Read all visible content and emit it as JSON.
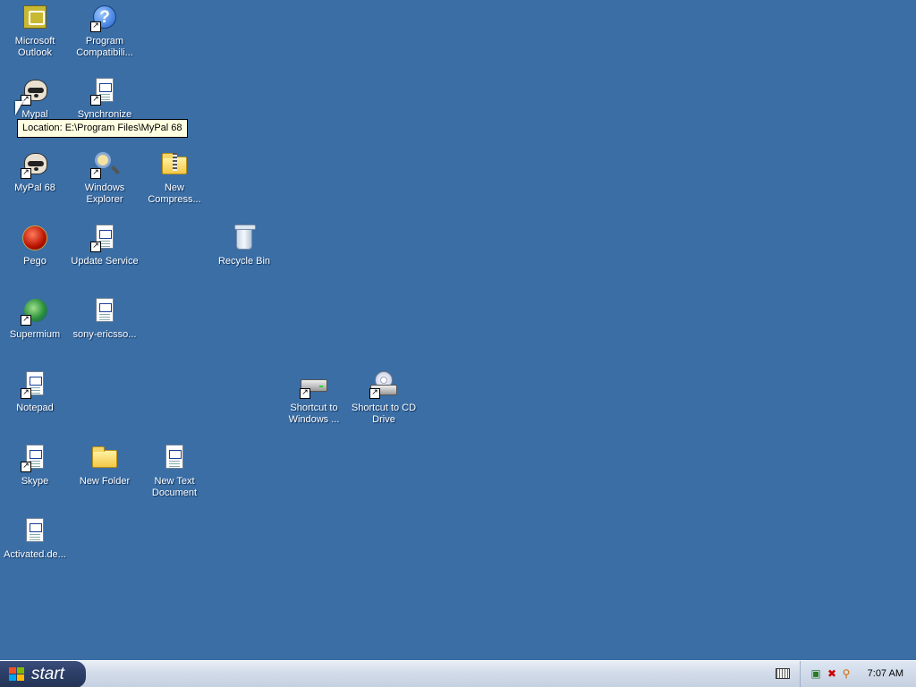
{
  "desktop": {
    "icons": [
      {
        "label": "Microsoft Outlook",
        "icon": "outlook-icon"
      },
      {
        "label": "Program Compatibili...",
        "icon": "help-icon"
      },
      {
        "label": "Mypal",
        "icon": "raccoon-icon"
      },
      {
        "label": "Synchronize",
        "icon": "document-icon"
      },
      {
        "label": "MyPal 68",
        "icon": "raccoon-icon"
      },
      {
        "label": "Windows Explorer",
        "icon": "magnifier-icon"
      },
      {
        "label": "New Compress...",
        "icon": "zip-folder-icon"
      },
      {
        "label": "Pego",
        "icon": "pego-icon"
      },
      {
        "label": "Update Service",
        "icon": "document-icon"
      },
      {
        "label": "Recycle Bin",
        "icon": "recycle-bin-icon"
      },
      {
        "label": "Supermium",
        "icon": "browser-globe-icon"
      },
      {
        "label": "sony-ericsso...",
        "icon": "document-icon"
      },
      {
        "label": "Notepad",
        "icon": "document-icon"
      },
      {
        "label": "Shortcut to Windows ...",
        "icon": "hard-drive-icon"
      },
      {
        "label": "Shortcut to CD Drive",
        "icon": "cd-drive-icon"
      },
      {
        "label": "Skype",
        "icon": "document-icon"
      },
      {
        "label": "New Folder",
        "icon": "folder-icon"
      },
      {
        "label": "New Text Document",
        "icon": "document-icon"
      },
      {
        "label": "Activated.de...",
        "icon": "document-icon"
      }
    ]
  },
  "tooltip": {
    "text": "Location: E:\\Program Files\\MyPal 68"
  },
  "taskbar": {
    "start_label": "start",
    "clock": "7:07 AM",
    "tray_icons": [
      "keyboard-icon",
      "network-icon",
      "security-icon",
      "search-icon"
    ]
  }
}
